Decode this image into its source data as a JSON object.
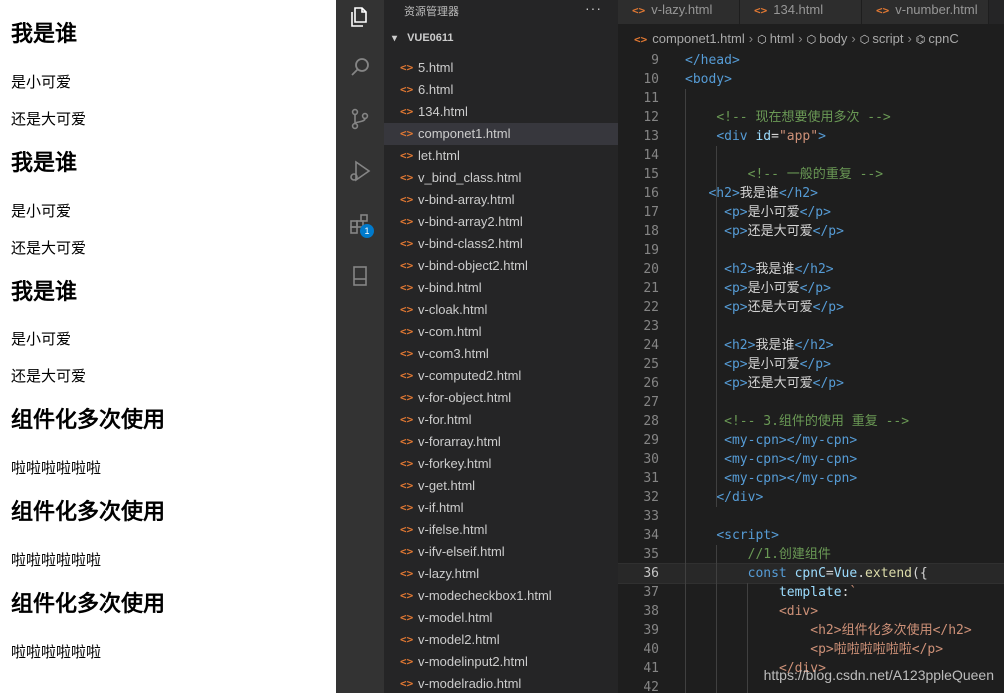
{
  "preview": {
    "blocks": [
      {
        "type": "h2",
        "text": "我是谁"
      },
      {
        "type": "p",
        "text": "是小可爱"
      },
      {
        "type": "p",
        "text": "还是大可爱"
      },
      {
        "type": "h2",
        "text": "我是谁"
      },
      {
        "type": "p",
        "text": "是小可爱"
      },
      {
        "type": "p",
        "text": "还是大可爱"
      },
      {
        "type": "h2",
        "text": "我是谁"
      },
      {
        "type": "p",
        "text": "是小可爱"
      },
      {
        "type": "p",
        "text": "还是大可爱"
      },
      {
        "type": "h2",
        "text": "组件化多次使用"
      },
      {
        "type": "p",
        "text": "啦啦啦啦啦啦"
      },
      {
        "type": "h2",
        "text": "组件化多次使用"
      },
      {
        "type": "p",
        "text": "啦啦啦啦啦啦"
      },
      {
        "type": "h2",
        "text": "组件化多次使用"
      },
      {
        "type": "p",
        "text": "啦啦啦啦啦啦"
      }
    ]
  },
  "activity_bar": {
    "icons": [
      "files-icon",
      "search-icon",
      "source-control-icon",
      "run-debug-icon",
      "extensions-icon",
      "bookmark-icon"
    ],
    "extensions_badge": "1"
  },
  "sidebar": {
    "title": "资源管理器",
    "more": "···",
    "folder": "VUE0611",
    "active_file": "componet1.html",
    "files": [
      "5.html",
      "6.html",
      "134.html",
      "componet1.html",
      "let.html",
      "v_bind_class.html",
      "v-bind-array.html",
      "v-bind-array2.html",
      "v-bind-class2.html",
      "v-bind-object2.html",
      "v-bind.html",
      "v-cloak.html",
      "v-com.html",
      "v-com3.html",
      "v-computed2.html",
      "v-for-object.html",
      "v-for.html",
      "v-forarray.html",
      "v-forkey.html",
      "v-get.html",
      "v-if.html",
      "v-ifelse.html",
      "v-ifv-elseif.html",
      "v-lazy.html",
      "v-modecheckbox1.html",
      "v-model.html",
      "v-model2.html",
      "v-modelinput2.html",
      "v-modelradio.html"
    ]
  },
  "editor": {
    "tabs": [
      "v-lazy.html",
      "134.html",
      "v-number.html"
    ],
    "breadcrumb": [
      "componet1.html",
      "html",
      "body",
      "script",
      "cpnC"
    ],
    "current_line": 36,
    "lines": [
      {
        "n": 9,
        "tokens": [
          [
            "t-tag",
            "</head>"
          ]
        ],
        "indent": 0
      },
      {
        "n": 10,
        "tokens": [
          [
            "t-tag",
            "<body>"
          ]
        ],
        "indent": 0
      },
      {
        "n": 11,
        "tokens": [],
        "indent": 0
      },
      {
        "n": 12,
        "tokens": [
          [
            "t-com",
            "<!-- 现在想要使用多次 -->"
          ]
        ],
        "indent": 4
      },
      {
        "n": 13,
        "tokens": [
          [
            "t-tag",
            "<div "
          ],
          [
            "t-attr",
            "id"
          ],
          [
            "t-punct",
            "="
          ],
          [
            "t-str",
            "\"app\""
          ],
          [
            "t-tag",
            ">"
          ]
        ],
        "indent": 4
      },
      {
        "n": 14,
        "tokens": [],
        "indent": 0
      },
      {
        "n": 15,
        "tokens": [
          [
            "t-com",
            "<!-- 一般的重复 -->"
          ]
        ],
        "indent": 8
      },
      {
        "n": 16,
        "tokens": [
          [
            "t-tag",
            "<h2>"
          ],
          [
            "t-txt",
            "我是谁"
          ],
          [
            "t-tag",
            "</h2>"
          ]
        ],
        "indent": 3
      },
      {
        "n": 17,
        "tokens": [
          [
            "t-tag",
            "<p>"
          ],
          [
            "t-txt",
            "是小可爱"
          ],
          [
            "t-tag",
            "</p>"
          ]
        ],
        "indent": 5
      },
      {
        "n": 18,
        "tokens": [
          [
            "t-tag",
            "<p>"
          ],
          [
            "t-txt",
            "还是大可爱"
          ],
          [
            "t-tag",
            "</p>"
          ]
        ],
        "indent": 5
      },
      {
        "n": 19,
        "tokens": [],
        "indent": 0
      },
      {
        "n": 20,
        "tokens": [
          [
            "t-tag",
            "<h2>"
          ],
          [
            "t-txt",
            "我是谁"
          ],
          [
            "t-tag",
            "</h2>"
          ]
        ],
        "indent": 5
      },
      {
        "n": 21,
        "tokens": [
          [
            "t-tag",
            "<p>"
          ],
          [
            "t-txt",
            "是小可爱"
          ],
          [
            "t-tag",
            "</p>"
          ]
        ],
        "indent": 5
      },
      {
        "n": 22,
        "tokens": [
          [
            "t-tag",
            "<p>"
          ],
          [
            "t-txt",
            "还是大可爱"
          ],
          [
            "t-tag",
            "</p>"
          ]
        ],
        "indent": 5
      },
      {
        "n": 23,
        "tokens": [],
        "indent": 0
      },
      {
        "n": 24,
        "tokens": [
          [
            "t-tag",
            "<h2>"
          ],
          [
            "t-txt",
            "我是谁"
          ],
          [
            "t-tag",
            "</h2>"
          ]
        ],
        "indent": 5
      },
      {
        "n": 25,
        "tokens": [
          [
            "t-tag",
            "<p>"
          ],
          [
            "t-txt",
            "是小可爱"
          ],
          [
            "t-tag",
            "</p>"
          ]
        ],
        "indent": 5
      },
      {
        "n": 26,
        "tokens": [
          [
            "t-tag",
            "<p>"
          ],
          [
            "t-txt",
            "还是大可爱"
          ],
          [
            "t-tag",
            "</p>"
          ]
        ],
        "indent": 5
      },
      {
        "n": 27,
        "tokens": [],
        "indent": 0
      },
      {
        "n": 28,
        "tokens": [
          [
            "t-com",
            "<!-- 3.组件的使用 重复 -->"
          ]
        ],
        "indent": 5
      },
      {
        "n": 29,
        "tokens": [
          [
            "t-tag",
            "<my-cpn></my-cpn>"
          ]
        ],
        "indent": 5
      },
      {
        "n": 30,
        "tokens": [
          [
            "t-tag",
            "<my-cpn></my-cpn>"
          ]
        ],
        "indent": 5
      },
      {
        "n": 31,
        "tokens": [
          [
            "t-tag",
            "<my-cpn></my-cpn>"
          ]
        ],
        "indent": 5
      },
      {
        "n": 32,
        "tokens": [
          [
            "t-tag",
            "</div>"
          ]
        ],
        "indent": 4
      },
      {
        "n": 33,
        "tokens": [],
        "indent": 0
      },
      {
        "n": 34,
        "tokens": [
          [
            "t-tag",
            "<script>"
          ]
        ],
        "indent": 4
      },
      {
        "n": 35,
        "tokens": [
          [
            "t-com",
            "//1.创建组件"
          ]
        ],
        "indent": 8
      },
      {
        "n": 36,
        "tokens": [
          [
            "t-kw",
            "const "
          ],
          [
            "t-var",
            "cpnC"
          ],
          [
            "t-punct",
            "="
          ],
          [
            "t-var",
            "Vue"
          ],
          [
            "t-punct",
            "."
          ],
          [
            "t-fn",
            "extend"
          ],
          [
            "t-punct",
            "({"
          ]
        ],
        "indent": 8
      },
      {
        "n": 37,
        "tokens": [
          [
            "t-var",
            "template"
          ],
          [
            "t-punct",
            ":"
          ],
          [
            "t-tmpl",
            "`"
          ]
        ],
        "indent": 12
      },
      {
        "n": 38,
        "tokens": [
          [
            "t-tmpltag",
            "<div>"
          ]
        ],
        "indent": 12
      },
      {
        "n": 39,
        "tokens": [
          [
            "t-tmpltag",
            "<h2>组件化多次使用</h2>"
          ]
        ],
        "indent": 16
      },
      {
        "n": 40,
        "tokens": [
          [
            "t-tmpltag",
            "<p>啦啦啦啦啦啦</p>"
          ]
        ],
        "indent": 16
      },
      {
        "n": 41,
        "tokens": [
          [
            "t-tmpltag",
            "</div>"
          ]
        ],
        "indent": 12
      },
      {
        "n": 42,
        "tokens": [],
        "indent": 0
      }
    ]
  },
  "watermark": "https://blog.csdn.net/A123ppleQueen"
}
